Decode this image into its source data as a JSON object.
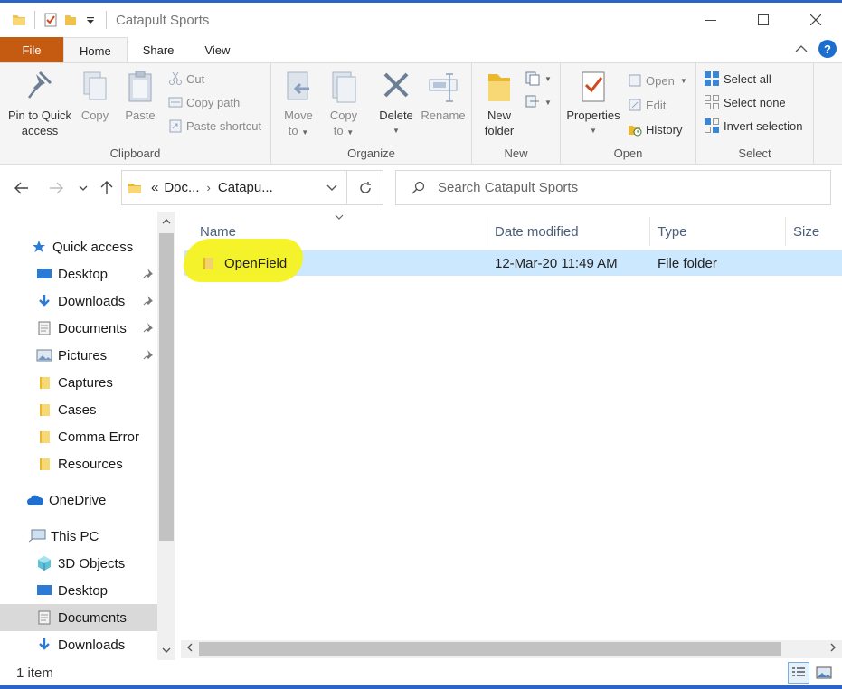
{
  "window": {
    "title": "Catapult Sports"
  },
  "ribbon_tabs": [
    {
      "label": "File"
    },
    {
      "label": "Home"
    },
    {
      "label": "Share"
    },
    {
      "label": "View"
    }
  ],
  "ribbon": {
    "clipboard": {
      "label": "Clipboard",
      "pin_line1": "Pin to Quick",
      "pin_line2": "access",
      "copy": "Copy",
      "paste": "Paste",
      "cut": "Cut",
      "copy_path": "Copy path",
      "paste_shortcut": "Paste shortcut"
    },
    "organize": {
      "label": "Organize",
      "move_line1": "Move",
      "move_line2": "to",
      "copy_line1": "Copy",
      "copy_line2": "to",
      "delete": "Delete",
      "rename": "Rename"
    },
    "new": {
      "label": "New",
      "new_folder_line1": "New",
      "new_folder_line2": "folder"
    },
    "open": {
      "label": "Open",
      "properties": "Properties",
      "open": "Open",
      "edit": "Edit",
      "history": "History"
    },
    "select": {
      "label": "Select",
      "select_all": "Select all",
      "select_none": "Select none",
      "invert_selection": "Invert selection"
    }
  },
  "address": {
    "overflow": "«",
    "crumbs": [
      "Doc...",
      "Catapu..."
    ]
  },
  "search": {
    "placeholder": "Search Catapult Sports"
  },
  "nav_pane": [
    {
      "label": "Quick access",
      "icon": "star-icon",
      "pinned": false
    },
    {
      "label": "Desktop",
      "icon": "desktop-icon",
      "pinned": true
    },
    {
      "label": "Downloads",
      "icon": "download-icon",
      "pinned": true
    },
    {
      "label": "Documents",
      "icon": "document-icon",
      "pinned": true
    },
    {
      "label": "Pictures",
      "icon": "picture-icon",
      "pinned": true
    },
    {
      "label": "Captures",
      "icon": "folder-icon",
      "pinned": false
    },
    {
      "label": "Cases",
      "icon": "folder-icon",
      "pinned": false
    },
    {
      "label": "Comma Error",
      "icon": "folder-icon",
      "pinned": false
    },
    {
      "label": "Resources",
      "icon": "folder-icon",
      "pinned": false
    },
    {
      "label": "OneDrive",
      "icon": "cloud-icon",
      "pinned": false
    },
    {
      "label": "This PC",
      "icon": "computer-icon",
      "pinned": false
    },
    {
      "label": "3D Objects",
      "icon": "cube-icon",
      "pinned": false
    },
    {
      "label": "Desktop",
      "icon": "desktop-icon",
      "pinned": false
    },
    {
      "label": "Documents",
      "icon": "document-icon",
      "pinned": false,
      "selected": true
    },
    {
      "label": "Downloads",
      "icon": "download-icon",
      "pinned": false
    }
  ],
  "columns": [
    {
      "label": "Name"
    },
    {
      "label": "Date modified"
    },
    {
      "label": "Type"
    },
    {
      "label": "Size"
    }
  ],
  "files": [
    {
      "name": "OpenField",
      "date_modified": "12-Mar-20 11:49 AM",
      "type": "File folder",
      "size": ""
    }
  ],
  "status": {
    "item_count": "1 item"
  },
  "colors": {
    "accent": "#2b63c6",
    "file_tab": "#c55a11",
    "selection": "#cce8ff",
    "highlight": "#f6f21f"
  }
}
